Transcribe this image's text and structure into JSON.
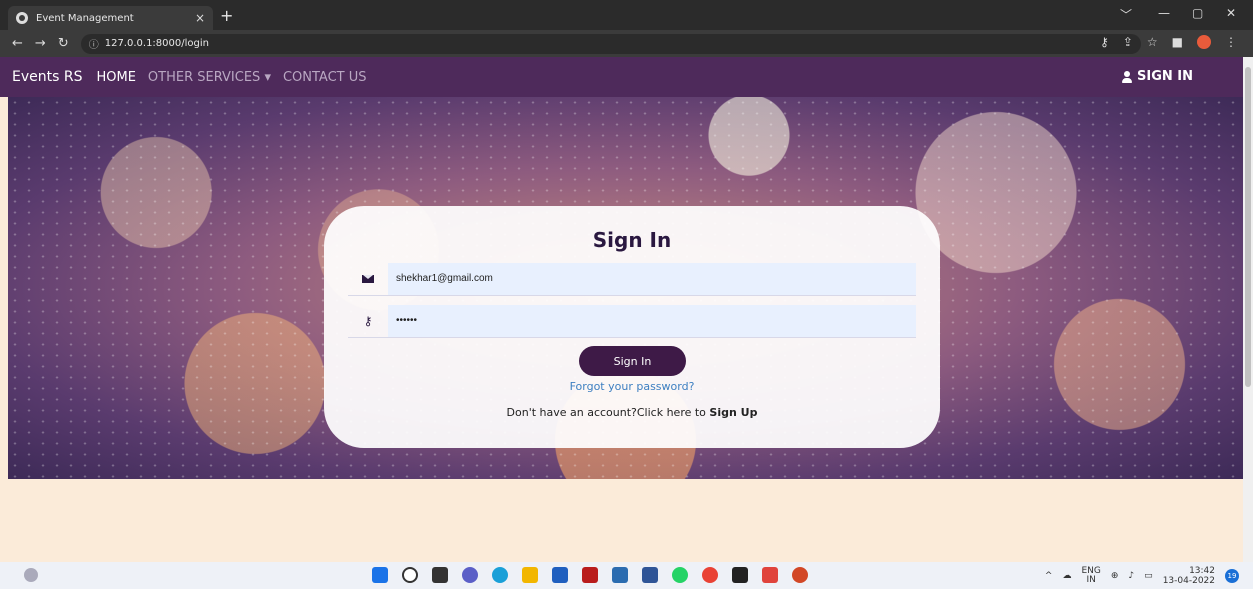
{
  "browser": {
    "tab_title": "Event Management",
    "tab_close": "×",
    "new_tab": "+",
    "url": "127.0.0.1:8000/login",
    "window_controls": [
      "﹀",
      "—",
      "▢",
      "✕"
    ]
  },
  "navbar": {
    "brand": "Events RS",
    "links": [
      "HOME",
      "OTHER SERVICES ▾",
      "CONTACT US"
    ],
    "signin": "SIGN IN"
  },
  "form": {
    "title": "Sign In",
    "email_value": "shekhar1@gmail.com",
    "password_value": "••••••",
    "button": "Sign In",
    "forgot": "Forgot your password?",
    "signup_prefix": "Don't have an account?Click here to ",
    "signup_link": "Sign Up"
  },
  "taskbar": {
    "lang_top": "ENG",
    "lang_bottom": "IN",
    "time": "13:42",
    "date": "13-04-2022",
    "badge": "19"
  },
  "colors": {
    "navbar": "#4e2a5b",
    "button": "#3e1a47",
    "link": "#3d7fc1",
    "page_bg": "#fbebd9"
  }
}
